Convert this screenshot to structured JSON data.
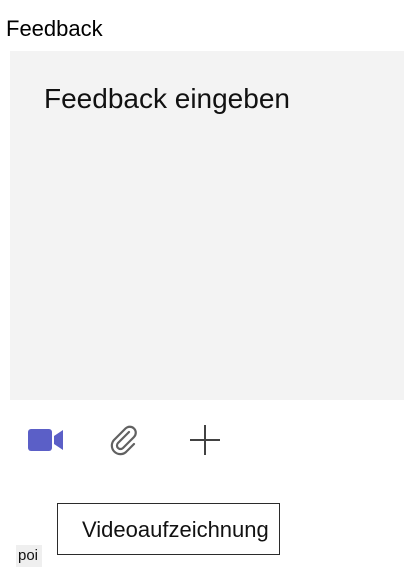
{
  "section": {
    "title": "Feedback"
  },
  "feedback_input": {
    "placeholder": "Feedback eingeben"
  },
  "toolbar": {
    "buttons": [
      {
        "icon": "video-camera-icon",
        "color": "#5b5fc7"
      },
      {
        "icon": "paperclip-icon",
        "color": "#616161"
      },
      {
        "icon": "plus-icon",
        "color": "#424242"
      }
    ]
  },
  "tooltip": {
    "text": "Videoaufzeichnung"
  },
  "hint": {
    "text": "poi"
  }
}
